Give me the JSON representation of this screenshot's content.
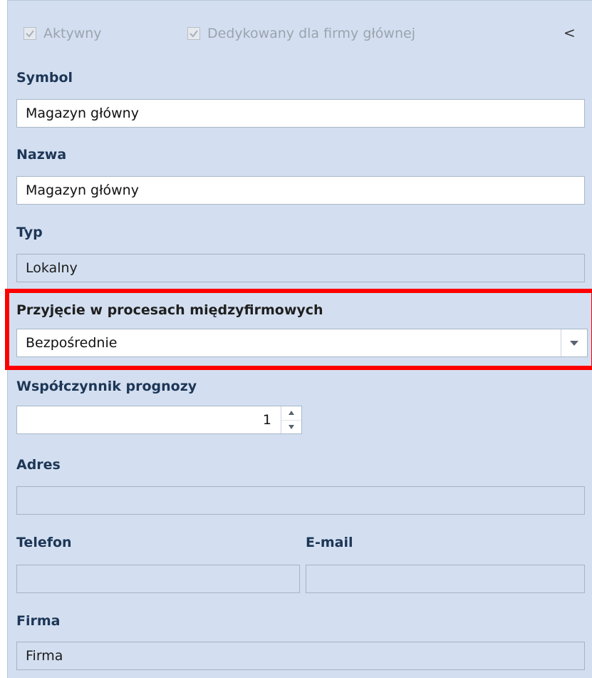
{
  "header": {
    "aktywny_label": "Aktywny",
    "dedykowany_label": "Dedykowany dla firmy głównej",
    "collapse_glyph": "<"
  },
  "symbol": {
    "label": "Symbol",
    "value": "Magazyn główny"
  },
  "nazwa": {
    "label": "Nazwa",
    "value": "Magazyn główny"
  },
  "typ": {
    "label": "Typ",
    "value": "Lokalny"
  },
  "przyjecie": {
    "label": "Przyjęcie w procesach międzyfirmowych",
    "value": "Bezpośrednie"
  },
  "wspolczynnik": {
    "label": "Współczynnik prognozy",
    "value": "1"
  },
  "adres": {
    "label": "Adres",
    "value": ""
  },
  "telefon": {
    "label": "Telefon",
    "value": ""
  },
  "email": {
    "label": "E-mail",
    "value": ""
  },
  "firma": {
    "label": "Firma",
    "value": "Firma"
  },
  "colors": {
    "panel_bg": "#d3dff0",
    "label_blue": "#1d3656",
    "highlight": "#ff0000"
  },
  "icons": {
    "checkbox": "checkmark-icon",
    "dropdown": "chevron-down-icon",
    "collapse": "chevron-left-icon"
  }
}
